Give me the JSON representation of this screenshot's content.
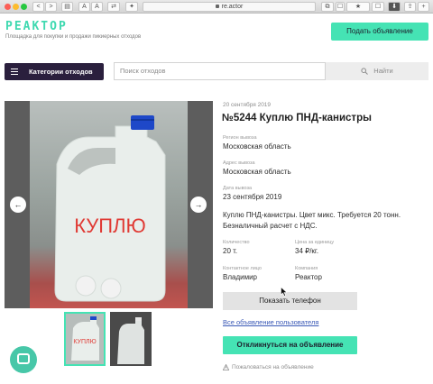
{
  "browser": {
    "url": "re.actor",
    "buttons": [
      "<",
      ">",
      "▤",
      "A",
      "A",
      "⇄",
      "✦",
      "⧉",
      "☐",
      "★",
      "⬇",
      "⇪",
      "+"
    ]
  },
  "header": {
    "logo": "РЕАКТОР",
    "tagline": "Площадка для покупки и продажи пикиерных отходов",
    "post_button": "Подать объявление"
  },
  "search_bar": {
    "categories_button": "Категории отходов",
    "placeholder": "Поиск отходов",
    "find_button": "Найти"
  },
  "gallery": {
    "photo_text": "КУПЛЮ",
    "prev": "←",
    "next": "→",
    "thumb_text": "КУПЛЮ"
  },
  "listing": {
    "date": "20 сентября 2019",
    "title": "№5244 Куплю ПНД-канистры",
    "region_label": "Регион вывоза",
    "region": "Московская область",
    "address_label": "Адрес вывоза",
    "address": "Московская область",
    "pickup_label": "Дата вывоза",
    "pickup_date": "23 сентября 2019",
    "description": "Куплю ПНД-канистры. Цвет микс. Требуется 20 тонн. Безналичный расчет с НДС.",
    "quantity_label": "Количество",
    "quantity": "20 т.",
    "price_label": "Цена за единицу",
    "price": "34 ₽/кг.",
    "contact_label": "Контактное лицо",
    "contact": "Владимир",
    "company_label": "Компания",
    "company": "Реактор",
    "phone_button": "Показать телефон",
    "all_link": "Все объявление пользователя",
    "respond_button": "Откликнуться на объявление",
    "complain_link": "Пожаловаться на объявление"
  },
  "colors": {
    "accent": "#45e3b4",
    "dark": "#2a1f3d",
    "link": "#3a58b6"
  }
}
